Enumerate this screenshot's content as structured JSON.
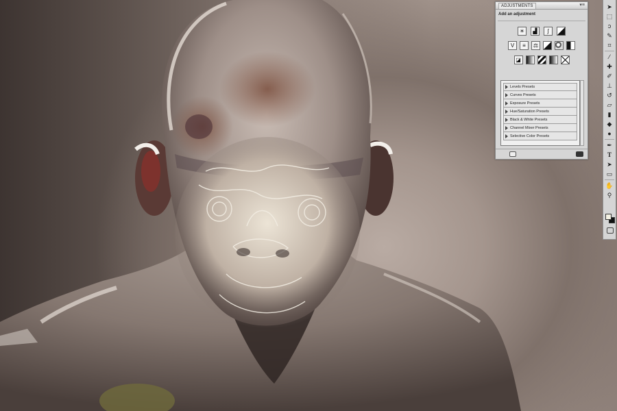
{
  "adjustments_panel": {
    "tab_title": "ADJUSTMENTS",
    "menu_glyph": "▾≡",
    "subtitle": "Add an adjustment",
    "icon_rows": [
      [
        "brightness-contrast-icon",
        "levels-icon",
        "curves-icon",
        "exposure-icon"
      ],
      [
        "vibrance-icon",
        "hue-saturation-icon",
        "color-balance-icon",
        "black-white-icon",
        "photo-filter-icon",
        "channel-mixer-icon"
      ],
      [
        "invert-icon",
        "posterize-icon",
        "threshold-icon",
        "gradient-map-icon",
        "selective-color-icon"
      ]
    ],
    "presets": [
      "Levels Presets",
      "Curves Presets",
      "Exposure Presets",
      "Hue/Saturation Presets",
      "Black & White Presets",
      "Channel Mixer Presets",
      "Selective Color Presets"
    ]
  },
  "tools": {
    "icons": [
      {
        "name": "move-tool-icon",
        "glyph": "➤"
      },
      {
        "name": "marquee-tool-icon",
        "glyph": "⬚"
      },
      {
        "name": "lasso-tool-icon",
        "glyph": "ↄ"
      },
      {
        "name": "quick-select-tool-icon",
        "glyph": "✎"
      },
      {
        "name": "crop-tool-icon",
        "glyph": "⌗"
      },
      {
        "name": "eyedropper-tool-icon",
        "glyph": "⁄"
      },
      {
        "name": "healing-brush-tool-icon",
        "glyph": "✚"
      },
      {
        "name": "brush-tool-icon",
        "glyph": "✐"
      },
      {
        "name": "clone-stamp-tool-icon",
        "glyph": "⊥"
      },
      {
        "name": "history-brush-tool-icon",
        "glyph": "↺"
      },
      {
        "name": "eraser-tool-icon",
        "glyph": "▱"
      },
      {
        "name": "gradient-tool-icon",
        "glyph": "▮"
      },
      {
        "name": "blur-tool-icon",
        "glyph": "◆"
      },
      {
        "name": "dodge-tool-icon",
        "glyph": "●"
      },
      {
        "name": "pen-tool-icon",
        "glyph": "✒"
      },
      {
        "name": "type-tool-icon",
        "glyph": "T"
      },
      {
        "name": "path-select-tool-icon",
        "glyph": "➤"
      },
      {
        "name": "shape-tool-icon",
        "glyph": "▭"
      },
      {
        "name": "hand-tool-icon",
        "glyph": "✋"
      },
      {
        "name": "zoom-tool-icon",
        "glyph": "⚲"
      }
    ],
    "foreground_color": "#f4f1e3",
    "background_color": "#111111"
  }
}
